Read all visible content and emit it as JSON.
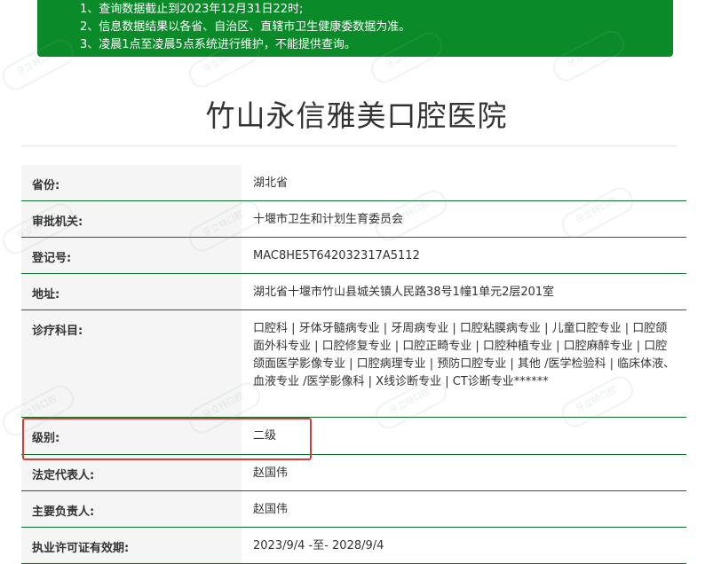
{
  "notice": {
    "lines": [
      "1、查询数据截止到2023年12月31日22时;",
      "2、信息数据结果以各省、自治区、直辖市卫生健康委数据为准。",
      "3、凌晨1点至凌晨5点系统进行维护，不能提供查询。"
    ]
  },
  "title": "竹山永信雅美口腔医院",
  "rows": [
    {
      "label": "省份:",
      "value": "湖北省"
    },
    {
      "label": "审批机关:",
      "value": "十堰市卫生和计划生育委员会"
    },
    {
      "label": "登记号:",
      "value": "MAC8HE5T642032317A5112"
    },
    {
      "label": "地址:",
      "value": "湖北省十堰市竹山县城关镇人民路38号1幢1单元2层201室"
    },
    {
      "label": "诊疗科目:",
      "value": "口腔科 | 牙体牙髓病专业 | 牙周病专业 | 口腔粘膜病专业 | 儿童口腔专业 | 口腔颌面外科专业 | 口腔修复专业 | 口腔正畸专业 | 口腔种植专业 | 口腔麻醉专业 | 口腔颌面医学影像专业 | 口腔病理专业 | 预防口腔专业 | 其他 /医学检验科 | 临床体液、血液专业 /医学影像科 | X线诊断专业 | CT诊断专业******"
    },
    {
      "label": "级别:",
      "value": "二级"
    },
    {
      "label": "法定代表人:",
      "value": "赵国伟"
    },
    {
      "label": "主要负责人:",
      "value": "赵国伟"
    },
    {
      "label": "执业许可证有效期:",
      "value": "2023/9/4 -至- 2028/9/4"
    }
  ],
  "colors": {
    "notice_bg": "#0a8a28",
    "border": "#0a6b2a",
    "highlight": "#e03a36"
  },
  "watermark": "牙立特口腔"
}
